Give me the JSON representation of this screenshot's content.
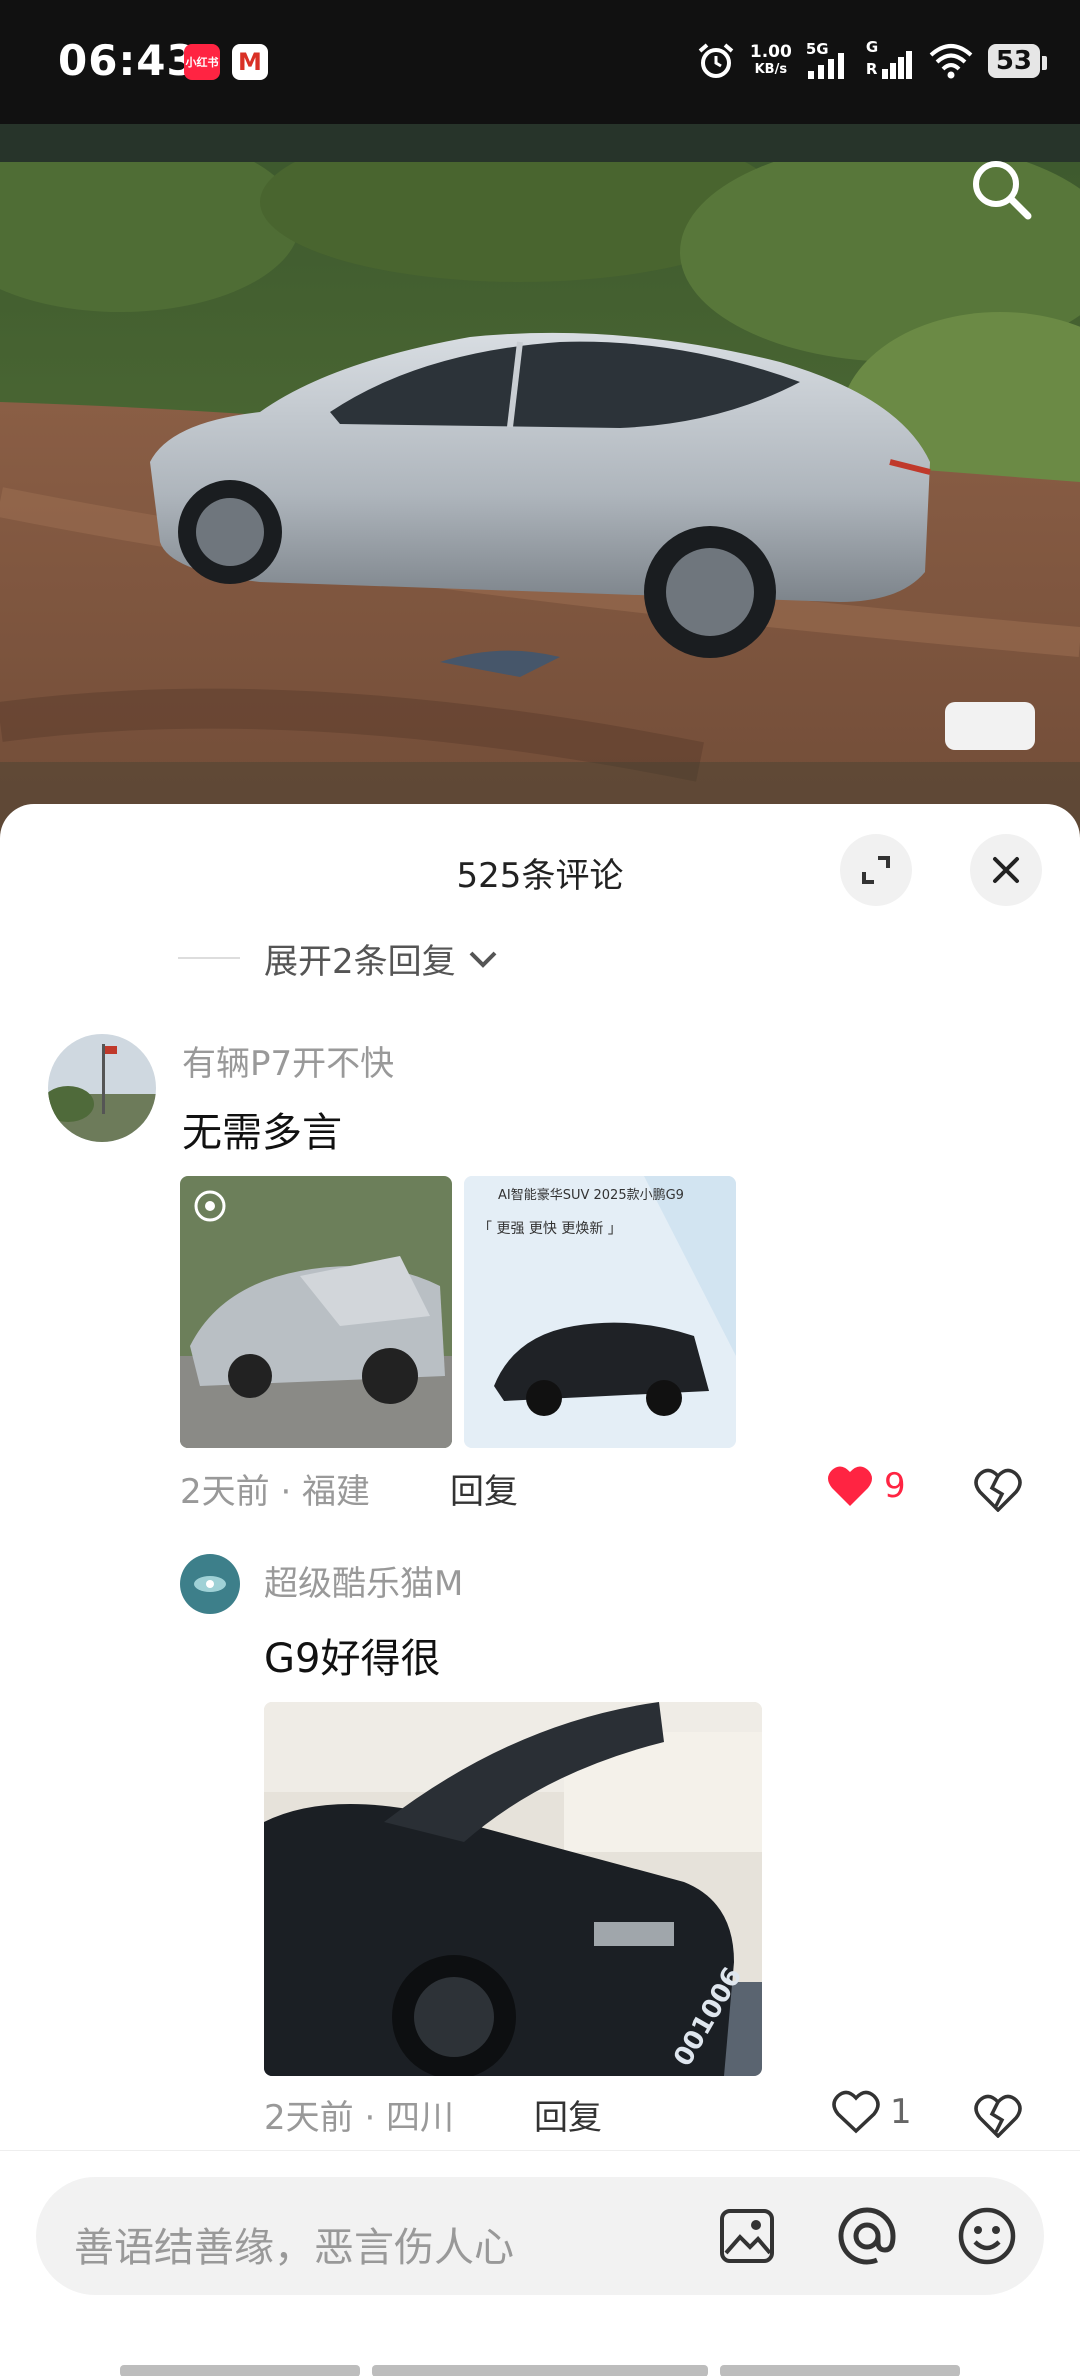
{
  "status": {
    "time": "06:43",
    "xhs_badge": "小红书",
    "gmail_badge": "M",
    "speed_top": "1.00",
    "speed_bottom": "KB/s",
    "net1": "5G",
    "net2_top": "G",
    "net2_bottom": "R",
    "battery": "53"
  },
  "sheet": {
    "title": "525条评论",
    "expand_replies": "展开2条回复"
  },
  "comments": [
    {
      "username": "有辆P7开不快",
      "text": "无需多言",
      "time": "2天前 · 福建",
      "reply": "回复",
      "likes": "9",
      "ad_header": "AI智能豪华SUV 2025款小鹏G9",
      "ad_slogan": "「 更强 更快 更焕新 」"
    },
    {
      "username": "超级酷乐猫M",
      "text": "G9好得很",
      "time": "2天前 · 四川",
      "reply": "回复",
      "likes": "1",
      "plate": "001006"
    }
  ],
  "input": {
    "placeholder": "善语结善缘，恶言伤人心"
  },
  "colors": {
    "like_red": "#ff2442",
    "sheet_bg": "#ffffff",
    "muted_text": "#999999"
  },
  "icons": [
    "search-icon",
    "expand-icon",
    "close-icon",
    "chevron-down-icon",
    "heart-icon",
    "broken-heart-icon",
    "image-icon",
    "at-icon",
    "emoji-icon"
  ]
}
